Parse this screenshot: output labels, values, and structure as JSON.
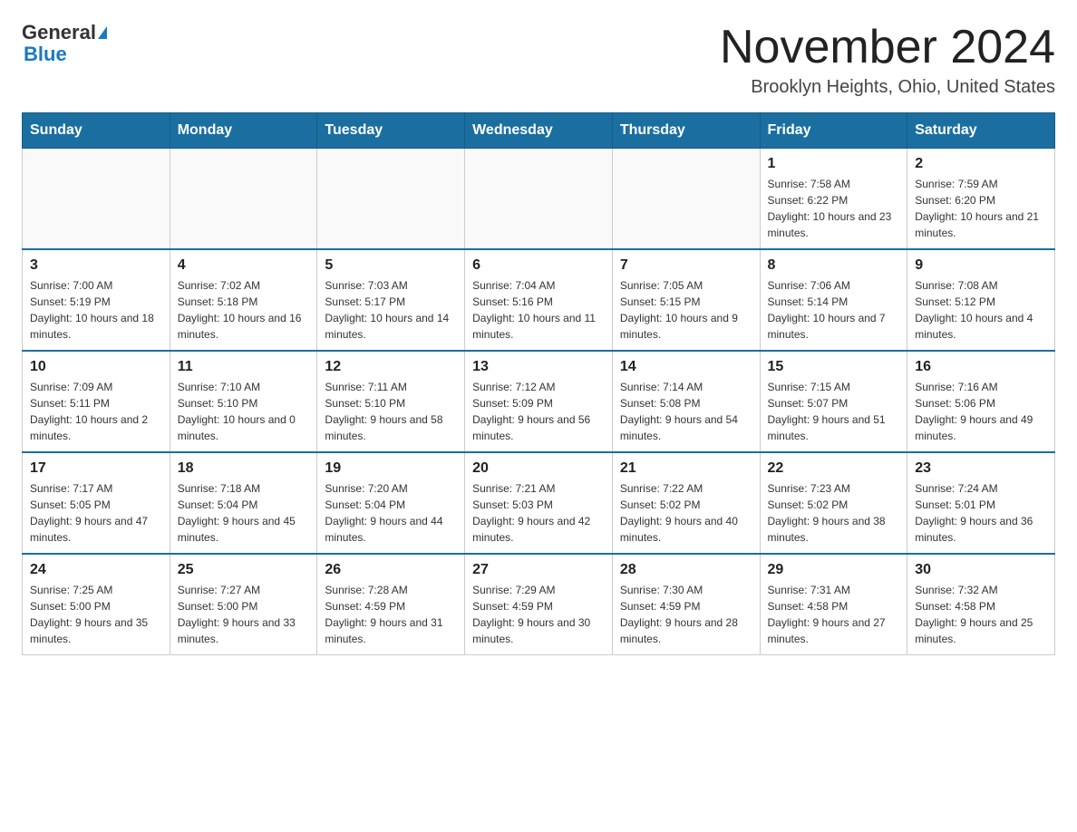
{
  "header": {
    "logo_line1": "General",
    "logo_line2": "Blue",
    "month_title": "November 2024",
    "location": "Brooklyn Heights, Ohio, United States"
  },
  "weekdays": [
    "Sunday",
    "Monday",
    "Tuesday",
    "Wednesday",
    "Thursday",
    "Friday",
    "Saturday"
  ],
  "weeks": [
    [
      {
        "day": "",
        "info": ""
      },
      {
        "day": "",
        "info": ""
      },
      {
        "day": "",
        "info": ""
      },
      {
        "day": "",
        "info": ""
      },
      {
        "day": "",
        "info": ""
      },
      {
        "day": "1",
        "info": "Sunrise: 7:58 AM\nSunset: 6:22 PM\nDaylight: 10 hours and 23 minutes."
      },
      {
        "day": "2",
        "info": "Sunrise: 7:59 AM\nSunset: 6:20 PM\nDaylight: 10 hours and 21 minutes."
      }
    ],
    [
      {
        "day": "3",
        "info": "Sunrise: 7:00 AM\nSunset: 5:19 PM\nDaylight: 10 hours and 18 minutes."
      },
      {
        "day": "4",
        "info": "Sunrise: 7:02 AM\nSunset: 5:18 PM\nDaylight: 10 hours and 16 minutes."
      },
      {
        "day": "5",
        "info": "Sunrise: 7:03 AM\nSunset: 5:17 PM\nDaylight: 10 hours and 14 minutes."
      },
      {
        "day": "6",
        "info": "Sunrise: 7:04 AM\nSunset: 5:16 PM\nDaylight: 10 hours and 11 minutes."
      },
      {
        "day": "7",
        "info": "Sunrise: 7:05 AM\nSunset: 5:15 PM\nDaylight: 10 hours and 9 minutes."
      },
      {
        "day": "8",
        "info": "Sunrise: 7:06 AM\nSunset: 5:14 PM\nDaylight: 10 hours and 7 minutes."
      },
      {
        "day": "9",
        "info": "Sunrise: 7:08 AM\nSunset: 5:12 PM\nDaylight: 10 hours and 4 minutes."
      }
    ],
    [
      {
        "day": "10",
        "info": "Sunrise: 7:09 AM\nSunset: 5:11 PM\nDaylight: 10 hours and 2 minutes."
      },
      {
        "day": "11",
        "info": "Sunrise: 7:10 AM\nSunset: 5:10 PM\nDaylight: 10 hours and 0 minutes."
      },
      {
        "day": "12",
        "info": "Sunrise: 7:11 AM\nSunset: 5:10 PM\nDaylight: 9 hours and 58 minutes."
      },
      {
        "day": "13",
        "info": "Sunrise: 7:12 AM\nSunset: 5:09 PM\nDaylight: 9 hours and 56 minutes."
      },
      {
        "day": "14",
        "info": "Sunrise: 7:14 AM\nSunset: 5:08 PM\nDaylight: 9 hours and 54 minutes."
      },
      {
        "day": "15",
        "info": "Sunrise: 7:15 AM\nSunset: 5:07 PM\nDaylight: 9 hours and 51 minutes."
      },
      {
        "day": "16",
        "info": "Sunrise: 7:16 AM\nSunset: 5:06 PM\nDaylight: 9 hours and 49 minutes."
      }
    ],
    [
      {
        "day": "17",
        "info": "Sunrise: 7:17 AM\nSunset: 5:05 PM\nDaylight: 9 hours and 47 minutes."
      },
      {
        "day": "18",
        "info": "Sunrise: 7:18 AM\nSunset: 5:04 PM\nDaylight: 9 hours and 45 minutes."
      },
      {
        "day": "19",
        "info": "Sunrise: 7:20 AM\nSunset: 5:04 PM\nDaylight: 9 hours and 44 minutes."
      },
      {
        "day": "20",
        "info": "Sunrise: 7:21 AM\nSunset: 5:03 PM\nDaylight: 9 hours and 42 minutes."
      },
      {
        "day": "21",
        "info": "Sunrise: 7:22 AM\nSunset: 5:02 PM\nDaylight: 9 hours and 40 minutes."
      },
      {
        "day": "22",
        "info": "Sunrise: 7:23 AM\nSunset: 5:02 PM\nDaylight: 9 hours and 38 minutes."
      },
      {
        "day": "23",
        "info": "Sunrise: 7:24 AM\nSunset: 5:01 PM\nDaylight: 9 hours and 36 minutes."
      }
    ],
    [
      {
        "day": "24",
        "info": "Sunrise: 7:25 AM\nSunset: 5:00 PM\nDaylight: 9 hours and 35 minutes."
      },
      {
        "day": "25",
        "info": "Sunrise: 7:27 AM\nSunset: 5:00 PM\nDaylight: 9 hours and 33 minutes."
      },
      {
        "day": "26",
        "info": "Sunrise: 7:28 AM\nSunset: 4:59 PM\nDaylight: 9 hours and 31 minutes."
      },
      {
        "day": "27",
        "info": "Sunrise: 7:29 AM\nSunset: 4:59 PM\nDaylight: 9 hours and 30 minutes."
      },
      {
        "day": "28",
        "info": "Sunrise: 7:30 AM\nSunset: 4:59 PM\nDaylight: 9 hours and 28 minutes."
      },
      {
        "day": "29",
        "info": "Sunrise: 7:31 AM\nSunset: 4:58 PM\nDaylight: 9 hours and 27 minutes."
      },
      {
        "day": "30",
        "info": "Sunrise: 7:32 AM\nSunset: 4:58 PM\nDaylight: 9 hours and 25 minutes."
      }
    ]
  ]
}
